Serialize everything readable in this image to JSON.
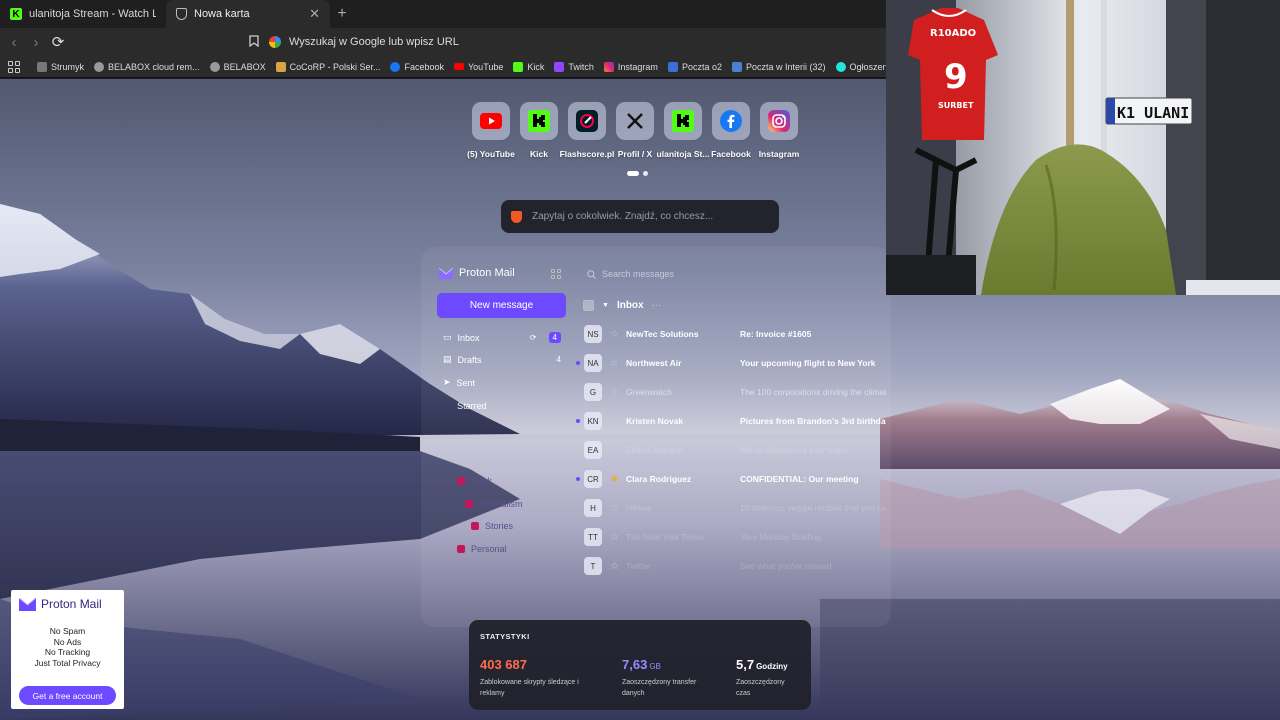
{
  "browser": {
    "tabs": [
      {
        "label": "ulanitoja Stream - Watch Live on Kick",
        "active": false
      },
      {
        "label": "Nowa karta",
        "active": true
      }
    ],
    "omnibox_placeholder": "Wyszukaj w Google lub wpisz URL",
    "bookmarks": [
      {
        "label": "Strumyk",
        "icon": "stream-icon"
      },
      {
        "label": "BELABOX cloud rem...",
        "icon": "globe-icon"
      },
      {
        "label": "BELABOX",
        "icon": "globe-icon"
      },
      {
        "label": "CoCoRP - Polski Ser...",
        "icon": "cocorp-icon"
      },
      {
        "label": "Facebook",
        "icon": "facebook-icon"
      },
      {
        "label": "YouTube",
        "icon": "youtube-icon"
      },
      {
        "label": "Kick",
        "icon": "kick-icon"
      },
      {
        "label": "Twitch",
        "icon": "twitch-icon"
      },
      {
        "label": "Instagram",
        "icon": "instagram-icon"
      },
      {
        "label": "Poczta o2",
        "icon": "o2-icon"
      },
      {
        "label": "Poczta w Interii (32)",
        "icon": "interia-icon"
      },
      {
        "label": "Ogłoszenia - Sprzed...",
        "icon": "olx-icon"
      }
    ]
  },
  "speed_dial": {
    "items": [
      {
        "label": "(5) YouTube",
        "icon": "youtube-icon"
      },
      {
        "label": "Kick",
        "icon": "kick-icon"
      },
      {
        "label": "Flashscore.pl",
        "icon": "flashscore-icon"
      },
      {
        "label": "Profil / X",
        "icon": "x-icon"
      },
      {
        "label": "ulanitoja St...",
        "icon": "kick-icon"
      },
      {
        "label": "Facebook",
        "icon": "facebook-icon"
      },
      {
        "label": "Instagram",
        "icon": "instagram-icon"
      }
    ],
    "search_placeholder": "Zapytaj o cokolwiek. Znajdź, co chcesz..."
  },
  "proton": {
    "logo": "Proton Mail",
    "search_placeholder": "Search messages",
    "new_message": "New message",
    "folders": [
      {
        "label": "Inbox",
        "count": "4"
      },
      {
        "label": "Drafts",
        "count": "4"
      },
      {
        "label": "Sent",
        "count": ""
      },
      {
        "label": "Starred",
        "count": ""
      }
    ],
    "labels": [
      {
        "label": "Work",
        "color": "#c2185b"
      },
      {
        "label": "Journalism",
        "color": "#c2185b"
      },
      {
        "label": "Stories",
        "color": "#c2185b"
      },
      {
        "label": "Personal",
        "color": "#c2185b"
      }
    ],
    "inbox_title": "Inbox",
    "messages": [
      {
        "initials": "NS",
        "sender": "NewTec Solutions",
        "subject": "Re: Invoice #1605",
        "unread": false,
        "starred": false,
        "style": "bold"
      },
      {
        "initials": "NA",
        "sender": "Northwest Air",
        "subject": "Your upcoming flight to New York",
        "unread": true,
        "starred": false,
        "style": "bold"
      },
      {
        "initials": "G",
        "sender": "Greenwatch",
        "subject": "The 100 corporations driving the climate",
        "unread": false,
        "starred": false,
        "style": "dim"
      },
      {
        "initials": "KN",
        "sender": "Kristen Novak",
        "subject": "Pictures from Brandon's 3rd birthday",
        "unread": true,
        "starred": false,
        "style": "bold"
      },
      {
        "initials": "EA",
        "sender": "Ethical Apparel",
        "subject": "We've dispatched your order",
        "unread": false,
        "starred": false,
        "style": "faint"
      },
      {
        "initials": "CR",
        "sender": "Clara Rodriguez",
        "subject": "CONFIDENTIAL: Our meeting",
        "unread": true,
        "starred": true,
        "style": "bold"
      },
      {
        "initials": "H",
        "sender": "HiHeal",
        "subject": "10 delicious veggie recipes that you can",
        "unread": false,
        "starred": false,
        "style": "faint"
      },
      {
        "initials": "TT",
        "sender": "The New York Times",
        "subject": "Your Monday Briefing",
        "unread": false,
        "starred": false,
        "style": "faint"
      },
      {
        "initials": "T",
        "sender": "Twitter",
        "subject": "See what you've missed",
        "unread": false,
        "starred": false,
        "style": "faint"
      }
    ]
  },
  "stats": {
    "title": "STATYSTYKI",
    "items": [
      {
        "value": "403 687",
        "unit": "",
        "desc": "Zablokowane skrypty śledzące i reklamy",
        "color": "#ff6d4d"
      },
      {
        "value": "7,63",
        "unit": "GB",
        "desc": "Zaoszczędzony transfer danych",
        "color": "#9a8cff"
      },
      {
        "value": "5,7",
        "unit": "Godziny",
        "desc": "Zaoszczędzony czas",
        "color": "#ffffff"
      }
    ]
  },
  "ad": {
    "logo": "Proton Mail",
    "lines": [
      "No Spam",
      "No Ads",
      "No Tracking",
      "Just Total Privacy"
    ],
    "cta": "Get a free account"
  },
  "webcam": {
    "jersey_text": "R10ADO",
    "jersey_number": "9",
    "jersey_sponsor": "SURBET",
    "plate_text": "K1 ULANI"
  },
  "colors": {
    "accent": "#6d4aff",
    "kick_green": "#53fc18",
    "stat_orange": "#ff6d4d"
  }
}
